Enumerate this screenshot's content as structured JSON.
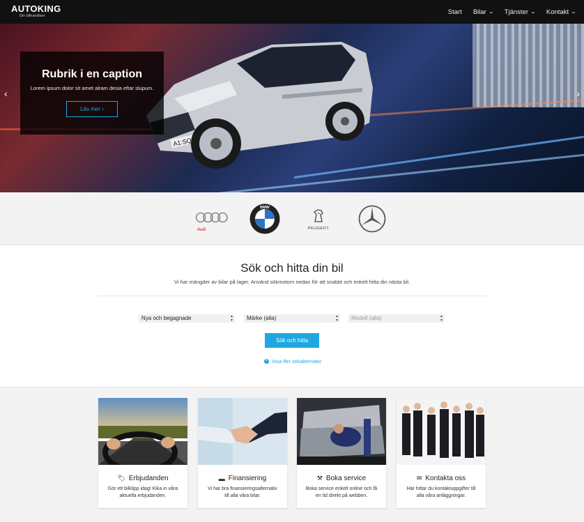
{
  "nav": {
    "logo": "AUTOKING",
    "logo_sub": "Din bilhandlare",
    "items": [
      {
        "label": "Start"
      },
      {
        "label": "Bilar"
      },
      {
        "label": "Tjänster"
      },
      {
        "label": "Kontakt"
      }
    ]
  },
  "hero": {
    "caption_title": "Rubrik i en caption",
    "caption_text": "Lorem ipsum dolor sit amet alram desia eftar slupum.",
    "caption_button": "Läs mer",
    "plate": "A1:SQ50"
  },
  "brands": [
    {
      "name": "Audi",
      "icon": "audi-logo"
    },
    {
      "name": "BMW",
      "icon": "bmw-logo"
    },
    {
      "name": "PEUGEOT",
      "icon": "peugeot-logo"
    },
    {
      "name": "Mercedes",
      "icon": "mercedes-logo"
    }
  ],
  "search": {
    "title": "Sök och hitta din bil",
    "subtitle": "Vi har mängder av bilar på lager. Använd sökmotorn nedan för att snabbt och enkelt hitta din nästa bil.",
    "condition_select": "Nya och begagnade",
    "make_select": "Märke (alla)",
    "model_select": "Modell (alla)",
    "button": "Sök och hitta",
    "more_link": "Visa fler sökalternativ"
  },
  "cards": [
    {
      "title": "Erbjudanden",
      "text": "Gör ett bilklipp idag! Kika in våra aktuella erbjudanden.",
      "icon": "tag-icon"
    },
    {
      "title": "Finansiering",
      "text": "Vi har bra finansieringsalternativ till alla våra bilar.",
      "icon": "credit-card-icon"
    },
    {
      "title": "Boka service",
      "text": "Boka service enkelt online och få en tid direkt på webben.",
      "icon": "tools-icon"
    },
    {
      "title": "Kontakta oss",
      "text": "Här hittar du kontaktuppgifter till alla våra anläggningar.",
      "icon": "envelope-icon"
    }
  ],
  "colors": {
    "accent": "#1ea7e1",
    "nav_bg": "#111111",
    "section_bg": "#f3f3f3"
  }
}
